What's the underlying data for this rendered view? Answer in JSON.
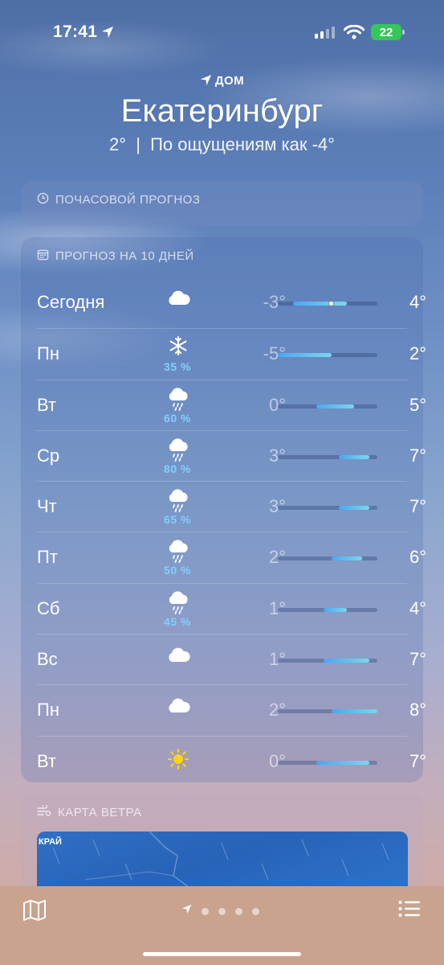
{
  "status_bar": {
    "time": "17:41",
    "battery": "22"
  },
  "header": {
    "location_label": "ДОМ",
    "city": "Екатеринбург",
    "current_temp": "2°",
    "separator": "|",
    "feels_like": "По ощущениям как -4°"
  },
  "hourly": {
    "title": "ПОЧАСОВОЙ ПРОГНОЗ"
  },
  "daily": {
    "title": "ПРОГНОЗ НА 10 ДНЕЙ",
    "range_scale": {
      "min": -5,
      "max": 8
    },
    "current_temp_value": 2,
    "days": [
      {
        "day": "Сегодня",
        "icon": "cloud-icon",
        "prob": "",
        "lo": "-3°",
        "hi": "4°",
        "lo_v": -3,
        "hi_v": 4
      },
      {
        "day": "Пн",
        "icon": "snowflake-icon",
        "prob": "35 %",
        "lo": "-5°",
        "hi": "2°",
        "lo_v": -5,
        "hi_v": 2
      },
      {
        "day": "Вт",
        "icon": "rain-cloud-icon",
        "prob": "60 %",
        "lo": "0°",
        "hi": "5°",
        "lo_v": 0,
        "hi_v": 5
      },
      {
        "day": "Ср",
        "icon": "rain-cloud-icon",
        "prob": "80 %",
        "lo": "3°",
        "hi": "7°",
        "lo_v": 3,
        "hi_v": 7
      },
      {
        "day": "Чт",
        "icon": "rain-cloud-icon",
        "prob": "65 %",
        "lo": "3°",
        "hi": "7°",
        "lo_v": 3,
        "hi_v": 7
      },
      {
        "day": "Пт",
        "icon": "rain-cloud-icon",
        "prob": "50 %",
        "lo": "2°",
        "hi": "6°",
        "lo_v": 2,
        "hi_v": 6
      },
      {
        "day": "Сб",
        "icon": "rain-cloud-icon",
        "prob": "45 %",
        "lo": "1°",
        "hi": "4°",
        "lo_v": 1,
        "hi_v": 4
      },
      {
        "day": "Вс",
        "icon": "cloud-icon",
        "prob": "",
        "lo": "1°",
        "hi": "7°",
        "lo_v": 1,
        "hi_v": 7
      },
      {
        "day": "Пн",
        "icon": "cloud-icon",
        "prob": "",
        "lo": "2°",
        "hi": "8°",
        "lo_v": 2,
        "hi_v": 8
      },
      {
        "day": "Вт",
        "icon": "sun-icon",
        "prob": "",
        "lo": "0°",
        "hi": "7°",
        "lo_v": 0,
        "hi_v": 7
      }
    ]
  },
  "wind": {
    "title": "КАРТА ВЕТРА",
    "map_label": "КРАЙ"
  },
  "colors": {
    "precip": "#7fd0ff",
    "bar_start": "#49a8f0",
    "bar_end": "#7cd6ee",
    "battery": "#35c759"
  }
}
